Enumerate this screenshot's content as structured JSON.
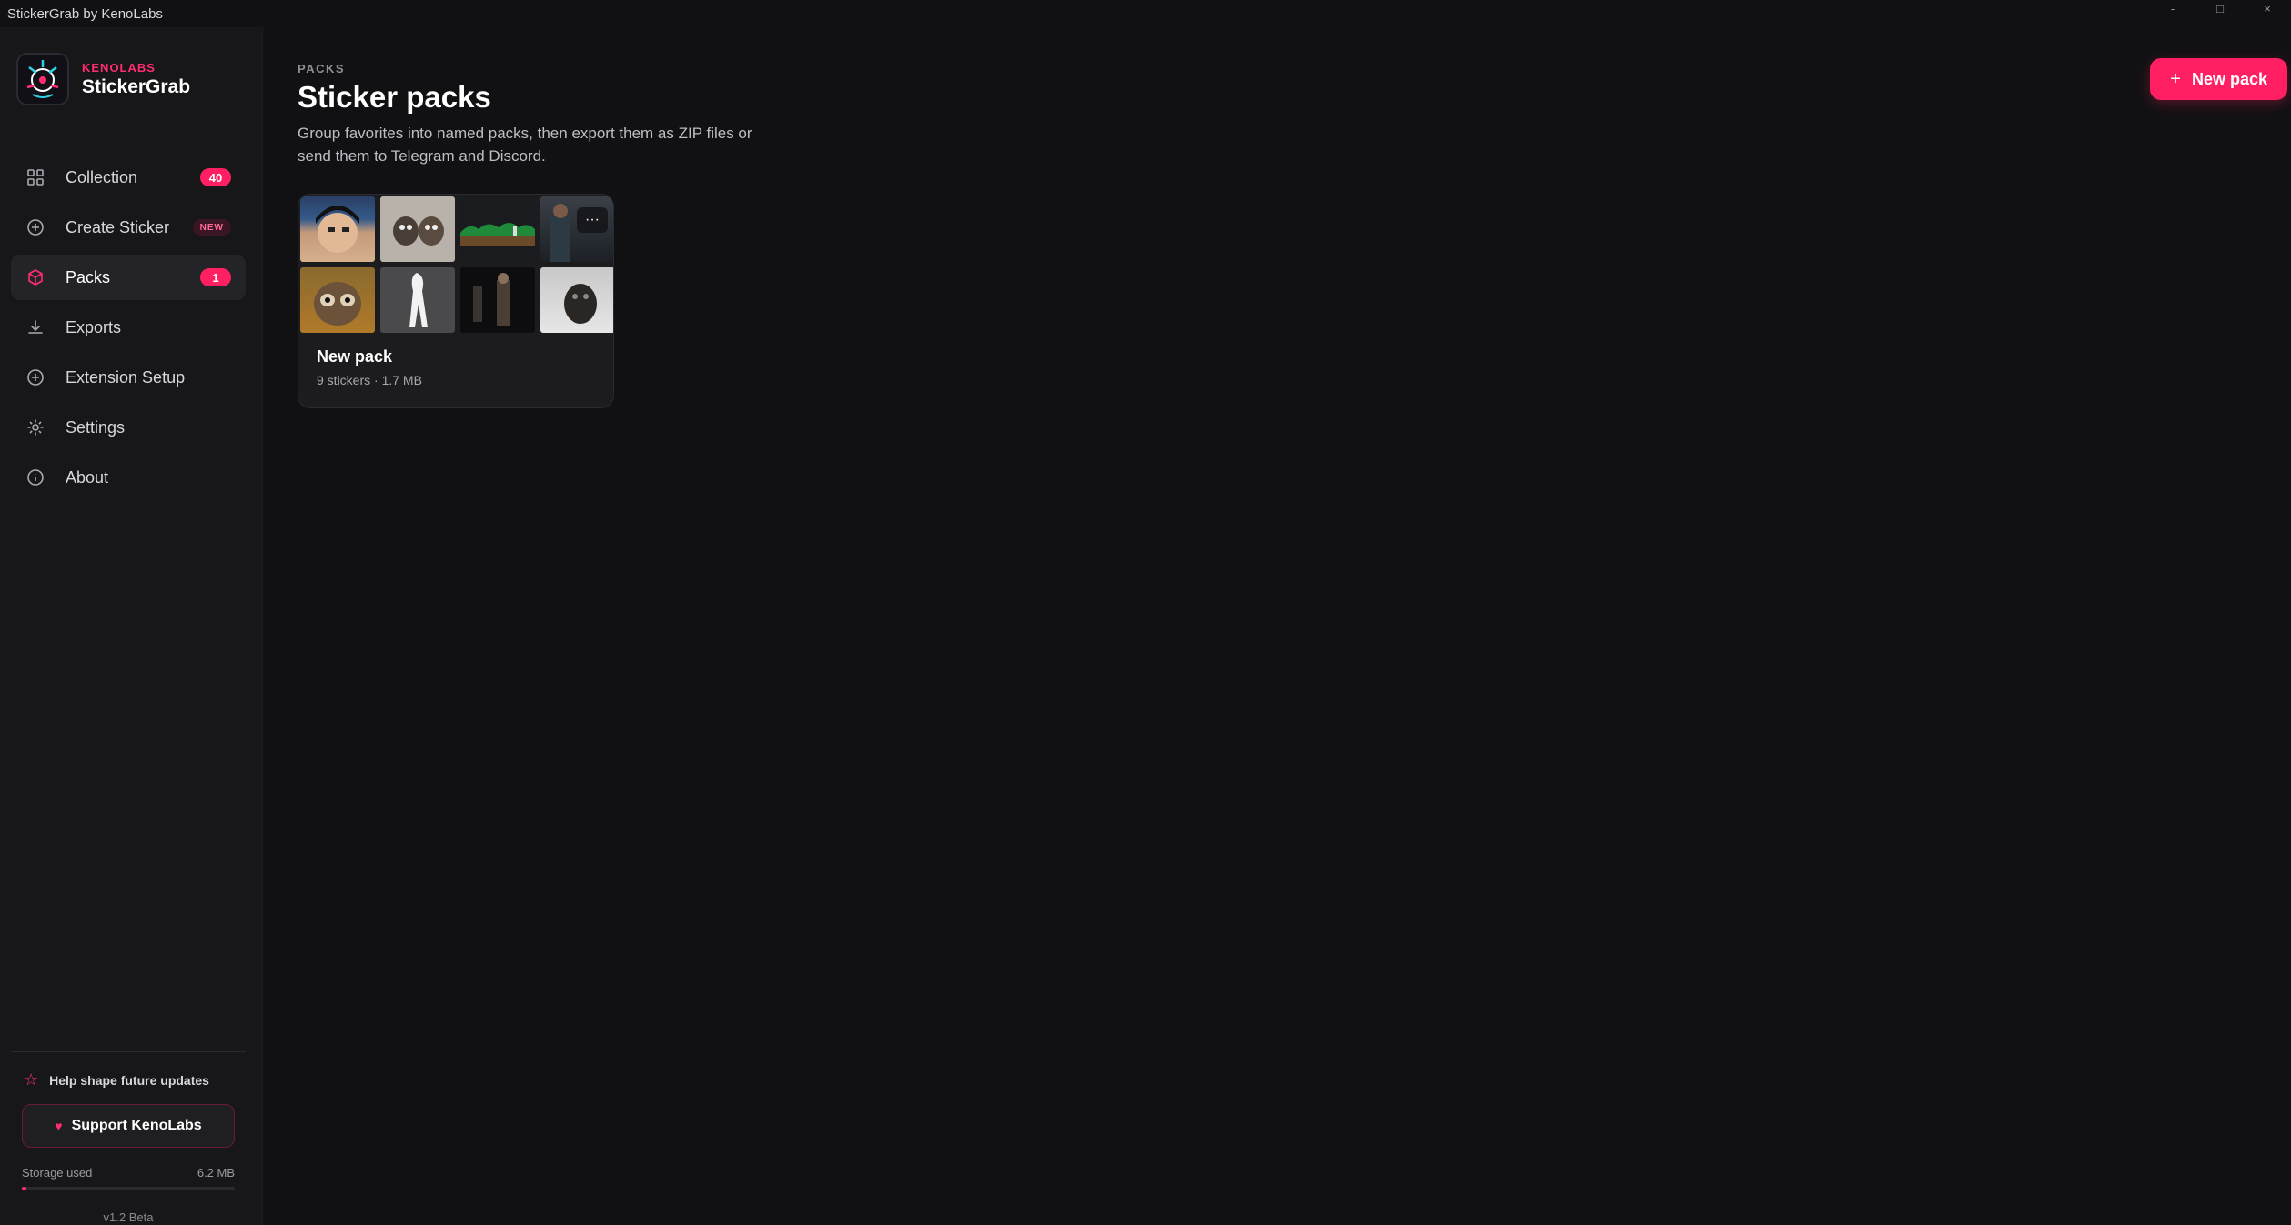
{
  "window": {
    "title": "StickerGrab by KenoLabs",
    "controls": {
      "minimize": "-",
      "maximize": "□",
      "close": "×"
    }
  },
  "brand": {
    "company": "KENOLABS",
    "name": "StickerGrab"
  },
  "sidebar": {
    "items": [
      {
        "label": "Collection",
        "icon": "grid-icon",
        "badge": "40"
      },
      {
        "label": "Create Sticker",
        "icon": "plus-circle-icon",
        "tag": "NEW"
      },
      {
        "label": "Packs",
        "icon": "box-icon",
        "badge": "1",
        "active": true
      },
      {
        "label": "Exports",
        "icon": "download-icon"
      },
      {
        "label": "Extension Setup",
        "icon": "plus-circle-icon"
      },
      {
        "label": "Settings",
        "icon": "gear-icon"
      },
      {
        "label": "About",
        "icon": "info-icon"
      }
    ],
    "footer": {
      "help_text": "Help shape future updates",
      "support_label": "Support KenoLabs",
      "storage_label": "Storage used",
      "storage_value": "6.2 MB",
      "storage_fraction": 0.02,
      "version": "v1.2 Beta"
    }
  },
  "header": {
    "eyebrow": "PACKS",
    "title": "Sticker packs",
    "description": "Group favorites into named packs, then export them as ZIP files or send them to Telegram and Discord.",
    "new_pack_label": "New pack"
  },
  "packs": [
    {
      "name": "New pack",
      "meta": "9 stickers · 1.7 MB",
      "more": "···"
    }
  ],
  "colors": {
    "accent": "#ff1f62",
    "background": "#111113",
    "sidebar": "#171719",
    "card": "#1c1c1f"
  }
}
